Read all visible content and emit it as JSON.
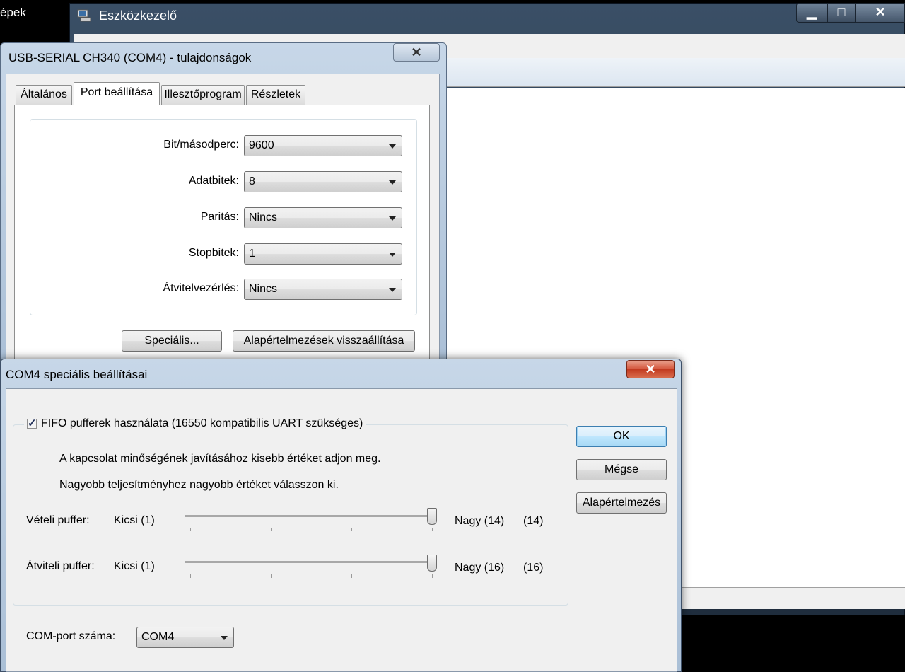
{
  "desktop": {
    "partial_label": "épek"
  },
  "device_manager": {
    "title": "Eszközkezelő",
    "min_glyph": "▁",
    "max_glyph": "□",
    "close_glyph": "✕"
  },
  "properties_dialog": {
    "title": "USB-SERIAL CH340 (COM4) - tulajdonságok",
    "close_glyph": "✕",
    "tabs": [
      {
        "label": "Általános"
      },
      {
        "label": "Port beállítása"
      },
      {
        "label": "Illesztőprogram"
      },
      {
        "label": "Részletek"
      }
    ],
    "fields": [
      {
        "label": "Bit/másodperc:",
        "value": "9600"
      },
      {
        "label": "Adatbitek:",
        "value": "8"
      },
      {
        "label": "Paritás:",
        "value": "Nincs"
      },
      {
        "label": "Stopbitek:",
        "value": "1"
      },
      {
        "label": "Átvitelvezérlés:",
        "value": "Nincs"
      }
    ],
    "advanced_button": "Speciális...",
    "restore_defaults_button": "Alapértelmezések visszaállítása"
  },
  "advanced_dialog": {
    "title": "COM4 speciális beállításai",
    "close_glyph": "✕",
    "fifo_label": "FIFO pufferek használata (16550 kompatibilis UART szükséges)",
    "fifo_checked": true,
    "hint_lower": "A kapcsolat minőségének javításához kisebb értéket adjon meg.",
    "hint_higher": "Nagyobb teljesítményhez nagyobb értéket válasszon ki.",
    "receive_buffer": {
      "label": "Vételi puffer:",
      "min_label": "Kicsi (1)",
      "max_label": "Nagy (14)",
      "current": "(14)",
      "value_fraction": 1.0
    },
    "transmit_buffer": {
      "label": "Átviteli puffer:",
      "min_label": "Kicsi (1)",
      "max_label": "Nagy (16)",
      "current": "(16)",
      "value_fraction": 1.0
    },
    "ok_button": "OK",
    "cancel_button": "Mégse",
    "defaults_button": "Alapértelmezés",
    "com_port_label": "COM-port száma:",
    "com_port_value": "COM4"
  }
}
